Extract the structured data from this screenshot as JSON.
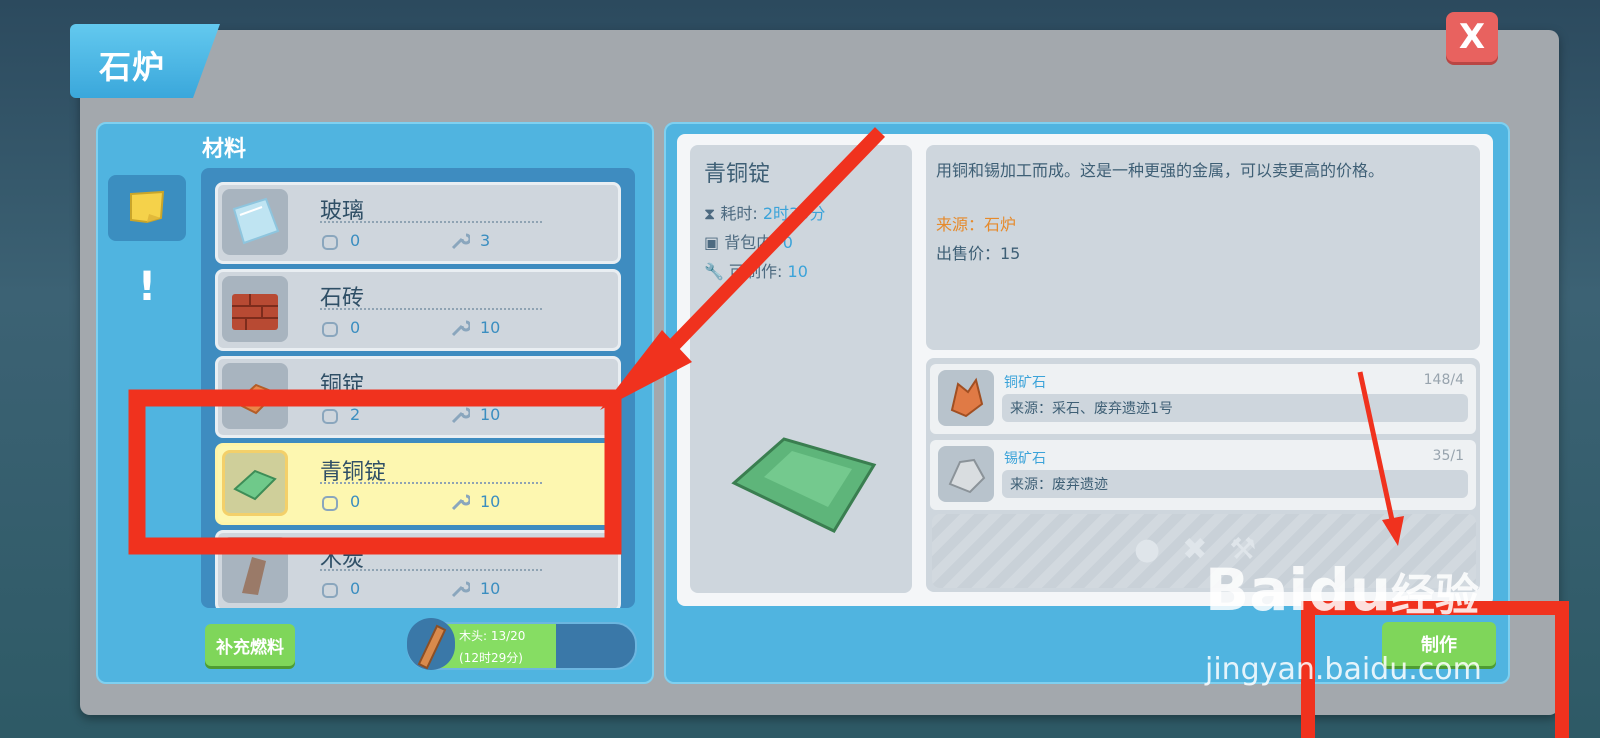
{
  "window": {
    "title": "石炉",
    "close_label": "X"
  },
  "left": {
    "section_label": "材料",
    "items": [
      {
        "name": "玻璃",
        "bag": "0",
        "tool": "3",
        "selected": false
      },
      {
        "name": "石砖",
        "bag": "0",
        "tool": "10",
        "selected": false
      },
      {
        "name": "铜锭",
        "bag": "2",
        "tool": "10",
        "selected": false
      },
      {
        "name": "青铜锭",
        "bag": "0",
        "tool": "10",
        "selected": true
      },
      {
        "name": "木炭",
        "bag": "0",
        "tool": "10",
        "selected": false
      }
    ],
    "fuel_button": "补充燃料",
    "wood_line1": "木头: 13/20",
    "wood_line2": "(12时29分)",
    "wood_progress": 0.65
  },
  "detail": {
    "name": "青铜锭",
    "time_label": "耗时:",
    "time_value": "2时30分",
    "bag_label": "背包内:",
    "bag_value": "0",
    "craft_label": "可制作:",
    "craft_value": "10",
    "description": "用铜和锡加工而成。这是一种更强的金属，可以卖更高的价格。",
    "source": "来源：石炉",
    "price": "出售价：15"
  },
  "materials": [
    {
      "name": "铜矿石",
      "count": "148/4",
      "source": "来源：采石、废弃遗迹1号"
    },
    {
      "name": "锡矿石",
      "count": "35/1",
      "source": "来源：废弃遗迹"
    }
  ],
  "make_button": "制作",
  "watermark": {
    "brand": "Baidu",
    "suffix": "经验",
    "url": "jingyan.baidu.com"
  },
  "colors": {
    "accent": "#50b4e0",
    "highlight": "#fdf7b0",
    "annotation": "#f0321e",
    "button": "#7fd65a"
  }
}
